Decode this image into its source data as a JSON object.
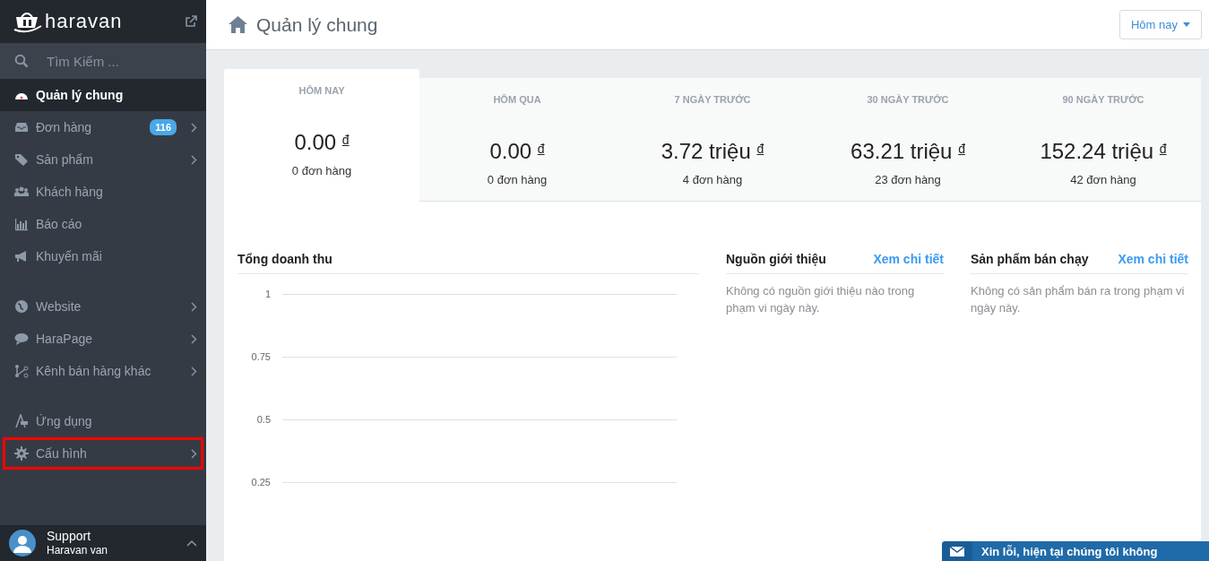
{
  "brand": {
    "name": "haravan"
  },
  "search": {
    "placeholder": "Tìm Kiếm ..."
  },
  "sidebar": {
    "groups": [
      [
        {
          "label": "Quản lý chung",
          "selected": true,
          "arrow": false,
          "highlighted": false
        },
        {
          "label": "Đơn hàng",
          "selected": false,
          "arrow": true,
          "badge": "116",
          "highlighted": false
        },
        {
          "label": "Sản phẩm",
          "selected": false,
          "arrow": true,
          "highlighted": false
        },
        {
          "label": "Khách hàng",
          "selected": false,
          "arrow": false,
          "highlighted": false
        },
        {
          "label": "Báo cáo",
          "selected": false,
          "arrow": false,
          "highlighted": false
        },
        {
          "label": "Khuyến mãi",
          "selected": false,
          "arrow": false,
          "highlighted": false
        }
      ],
      [
        {
          "label": "Website",
          "selected": false,
          "arrow": true,
          "highlighted": false
        },
        {
          "label": "HaraPage",
          "selected": false,
          "arrow": true,
          "highlighted": false
        },
        {
          "label": "Kênh bán hàng khác",
          "selected": false,
          "arrow": true,
          "highlighted": false
        }
      ],
      [
        {
          "label": "Ứng dụng",
          "selected": false,
          "arrow": false,
          "highlighted": false
        },
        {
          "label": "Cấu hình",
          "selected": false,
          "arrow": true,
          "highlighted": true
        }
      ]
    ]
  },
  "user": {
    "name": "Support",
    "store": "Haravan van"
  },
  "header": {
    "title": "Quản lý chung",
    "range_button": "Hôm nay"
  },
  "stats": [
    {
      "period": "HÔM NAY",
      "amount": "0.00",
      "currency": "đ",
      "orders": "0 đơn hàng",
      "selected": true
    },
    {
      "period": "HÔM QUA",
      "amount": "0.00",
      "currency": "đ",
      "orders": "0 đơn hàng",
      "selected": false
    },
    {
      "period": "7 NGÀY TRƯỚC",
      "amount": "3.72 triệu",
      "currency": "đ",
      "orders": "4 đơn hàng",
      "selected": false
    },
    {
      "period": "30 NGÀY TRƯỚC",
      "amount": "63.21 triệu",
      "currency": "đ",
      "orders": "23 đơn hàng",
      "selected": false
    },
    {
      "period": "90 NGÀY TRƯỚC",
      "amount": "152.24 triệu",
      "currency": "đ",
      "orders": "42 đơn hàng",
      "selected": false
    }
  ],
  "revenue": {
    "title": "Tổng doanh thu",
    "y_tick_labels": [
      "1",
      "0.75",
      "0.5",
      "0.25"
    ]
  },
  "lists": [
    {
      "title": "Nguồn giới thiệu",
      "link": "Xem chi tiết",
      "empty_text": "Không có nguồn giới thiệu nào trong phạm vi ngày này."
    },
    {
      "title": "Sản phẩm bán chạy",
      "link": "Xem chi tiết",
      "empty_text": "Không có sản phẩm bán ra trong phạm vi ngày này."
    }
  ],
  "chat_widget": {
    "text": "Xin lỗi, hiện tại chúng tôi không"
  }
}
